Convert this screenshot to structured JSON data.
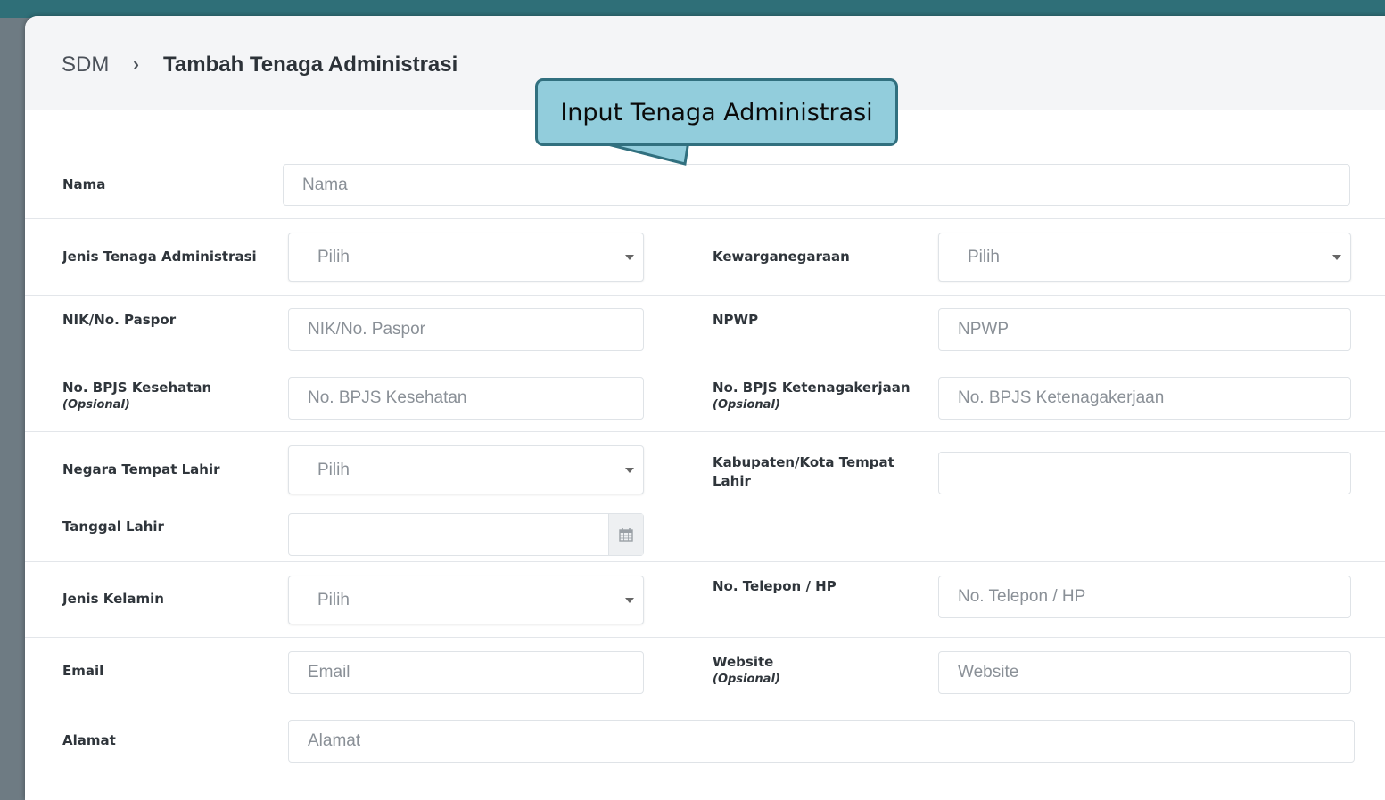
{
  "breadcrumb": {
    "root": "SDM",
    "separator": "›",
    "current": "Tambah Tenaga Administrasi"
  },
  "callout": {
    "text": "Input Tenaga Administrasi"
  },
  "icons": {
    "dropdown": "caret-down-icon",
    "calendar": "calendar-icon",
    "breadcrumb_separator": "chevron-right-icon"
  },
  "colors": {
    "callout_fill": "#92cddc",
    "callout_border": "#31707f",
    "header_bg": "#f4f5f7"
  },
  "form": {
    "optional_note": "(Opsional)",
    "nama": {
      "label": "Nama",
      "placeholder": "Nama"
    },
    "jenis_tenaga": {
      "label": "Jenis Tenaga Administrasi",
      "value": "Pilih"
    },
    "kewarganegaraan": {
      "label": "Kewarganegaraan",
      "value": "Pilih"
    },
    "nik": {
      "label": "NIK/No. Paspor",
      "placeholder": "NIK/No. Paspor"
    },
    "npwp": {
      "label": "NPWP",
      "placeholder": "NPWP"
    },
    "bpjs_kesehatan": {
      "label": "No. BPJS Kesehatan",
      "placeholder": "No. BPJS Kesehatan"
    },
    "bpjs_ketenagakerjaan": {
      "label": "No. BPJS Ketenagakerjaan",
      "placeholder": "No. BPJS Ketenagakerjaan"
    },
    "negara_lahir": {
      "label": "Negara Tempat Lahir",
      "value": "Pilih"
    },
    "kabupaten_lahir": {
      "label": "Kabupaten/Kota Tempat Lahir",
      "value": ""
    },
    "tanggal_lahir": {
      "label": "Tanggal Lahir",
      "value": ""
    },
    "jenis_kelamin": {
      "label": "Jenis Kelamin",
      "value": "Pilih"
    },
    "telepon": {
      "label": "No. Telepon / HP",
      "placeholder": "No. Telepon / HP"
    },
    "email": {
      "label": "Email",
      "placeholder": "Email"
    },
    "website": {
      "label": "Website",
      "placeholder": "Website"
    },
    "alamat": {
      "label": "Alamat",
      "placeholder": "Alamat"
    }
  }
}
